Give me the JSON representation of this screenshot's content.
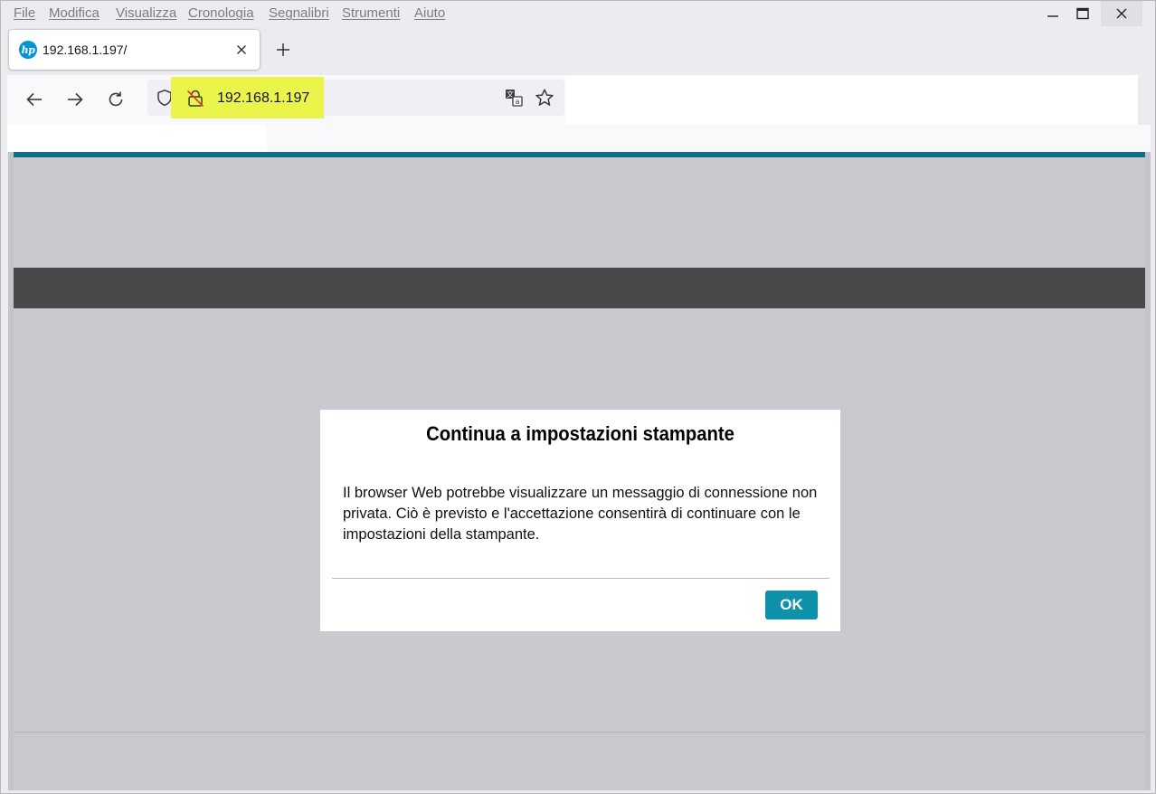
{
  "menu": {
    "items": [
      "File",
      "Modifica",
      "Visualizza",
      "Cronologia",
      "Segnalibri",
      "Strumenti",
      "Aiuto"
    ]
  },
  "window_controls": {
    "icons": [
      "minimize-icon",
      "maximize-icon",
      "close-icon"
    ]
  },
  "tab": {
    "favicon_text": "hp",
    "title": "192.168.1.197/"
  },
  "urlbar": {
    "url": "192.168.1.197",
    "icons": [
      "shield-icon",
      "insecure-lock-icon",
      "translate-icon",
      "star-icon"
    ]
  },
  "nav": {
    "icons": [
      "back-arrow-icon",
      "forward-arrow-icon",
      "reload-icon"
    ]
  },
  "dialog": {
    "title": "Continua a impostazioni stampante",
    "body": "Il browser Web potrebbe visualizzare un messaggio di connessione non privata. Ciò è previsto e l'accettazione consentirà di continuare con le impostazioni della stampante.",
    "ok_label": "OK"
  },
  "colors": {
    "accent_teal": "#0e91ab",
    "page_topline": "#0d6f82",
    "dark_band": "#48494b",
    "page_background": "#c9cacf",
    "url_highlight": "#eaf44a"
  }
}
